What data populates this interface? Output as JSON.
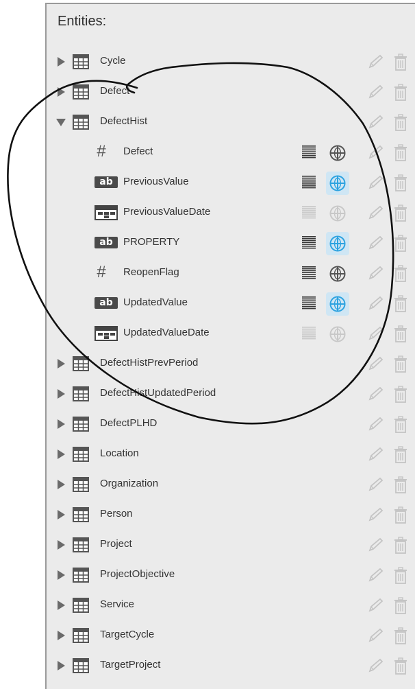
{
  "panel": {
    "title": "Entities:"
  },
  "entities": [
    {
      "label": "Cycle",
      "expanded": false
    },
    {
      "label": "Defect",
      "expanded": false
    },
    {
      "label": "DefectHist",
      "expanded": true
    },
    {
      "label": "DefectHistPrevPeriod",
      "expanded": false
    },
    {
      "label": "DefectHistUpdatedPeriod",
      "expanded": false
    },
    {
      "label": "DefectPLHD",
      "expanded": false
    },
    {
      "label": "Location",
      "expanded": false
    },
    {
      "label": "Organization",
      "expanded": false
    },
    {
      "label": "Person",
      "expanded": false
    },
    {
      "label": "Project",
      "expanded": false
    },
    {
      "label": "ProjectObjective",
      "expanded": false
    },
    {
      "label": "Service",
      "expanded": false
    },
    {
      "label": "TargetCycle",
      "expanded": false
    },
    {
      "label": "TargetProject",
      "expanded": false
    }
  ],
  "defect_hist_fields": [
    {
      "label": "Defect",
      "type": "number",
      "type_text": "#",
      "enabled": true,
      "globe_selected": false
    },
    {
      "label": "PreviousValue",
      "type": "text",
      "type_text": "ab",
      "enabled": true,
      "globe_selected": true
    },
    {
      "label": "PreviousValueDate",
      "type": "date",
      "type_text": "",
      "enabled": false,
      "globe_selected": false
    },
    {
      "label": "PROPERTY",
      "type": "text",
      "type_text": "ab",
      "enabled": true,
      "globe_selected": true
    },
    {
      "label": "ReopenFlag",
      "type": "number",
      "type_text": "#",
      "enabled": true,
      "globe_selected": false
    },
    {
      "label": "UpdatedValue",
      "type": "text",
      "type_text": "ab",
      "enabled": true,
      "globe_selected": true
    },
    {
      "label": "UpdatedValueDate",
      "type": "date",
      "type_text": "",
      "enabled": false,
      "globe_selected": false
    }
  ],
  "colors": {
    "panel_bg": "#ebebeb",
    "icon_dark": "#555555",
    "icon_disabled": "#c8c8c8",
    "globe_selected": "#2ea3e0",
    "globe_selected_bg": "#cfe6f4",
    "action_icon": "#c4c4c4"
  },
  "icons": {
    "expand": "triangle-right-icon",
    "collapse": "triangle-down-icon",
    "entity": "table-icon",
    "list": "list-lines-icon",
    "globe": "globe-icon",
    "edit": "pencil-icon",
    "delete": "trash-icon"
  }
}
